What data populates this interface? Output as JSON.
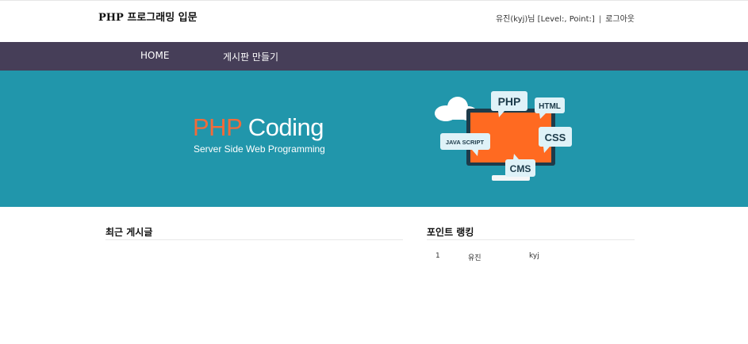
{
  "header": {
    "site_title": "PHP 프로그래밍 입문",
    "user_info": "유진(kyj)님 [Level:, Point:]",
    "separator": "|",
    "logout": "로그아웃"
  },
  "nav": {
    "items": [
      {
        "label": "HOME"
      },
      {
        "label": "게시판 만들기"
      }
    ]
  },
  "banner": {
    "title_accent": "PHP",
    "title_rest": " Coding",
    "subtitle": "Server Side Web Programming",
    "bubbles": {
      "php": "PHP",
      "html": "HTML",
      "css": "CSS",
      "js": "JAVA SCRIPT",
      "cms": "CMS"
    },
    "colors": {
      "background": "#2196ab",
      "accent": "#f26b3a"
    }
  },
  "latest_posts": {
    "title": "최근 게시글",
    "items": []
  },
  "point_ranking": {
    "title": "포인트 랭킹",
    "rows": [
      {
        "rank": "1",
        "name": "유진",
        "id": "kyj"
      }
    ]
  }
}
